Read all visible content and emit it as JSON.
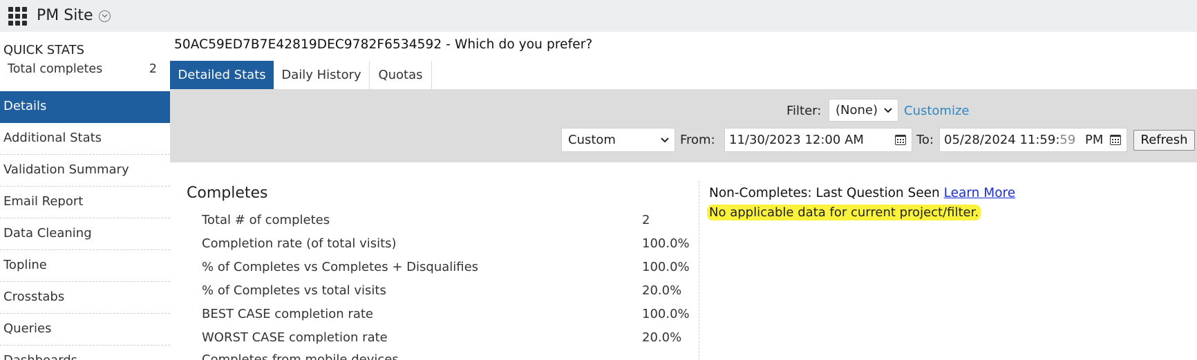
{
  "header": {
    "site_title": "PM Site"
  },
  "sidebar": {
    "quick_stats_title": "QUICK STATS",
    "quick_stats": [
      {
        "label": "Total completes",
        "value": "2"
      }
    ],
    "items": [
      {
        "label": "Details",
        "active": true
      },
      {
        "label": "Additional Stats"
      },
      {
        "label": "Validation Summary"
      },
      {
        "label": "Email Report"
      },
      {
        "label": "Data Cleaning"
      },
      {
        "label": "Topline"
      },
      {
        "label": "Crosstabs"
      },
      {
        "label": "Queries"
      },
      {
        "label": "Dashboards"
      }
    ]
  },
  "main": {
    "page_title": "50AC59ED7B7E42819DEC9782F6534592 - Which do you prefer?",
    "tabs": [
      {
        "label": "Detailed Stats",
        "active": true
      },
      {
        "label": "Daily History"
      },
      {
        "label": "Quotas"
      }
    ],
    "filter": {
      "filter_label": "Filter:",
      "filter_value": "(None)",
      "customize_label": "Customize",
      "range_value": "Custom",
      "from_label": "From:",
      "from_value": "11/30/2023 12:00 AM",
      "to_label": "To:",
      "to_value_main": "05/28/2024 11:59:",
      "to_value_seconds": "59",
      "to_value_ampm": "PM",
      "refresh_label": "Refresh"
    },
    "completes": {
      "title": "Completes",
      "rows": [
        {
          "label": "Total # of completes",
          "value": "2"
        },
        {
          "label": "Completion rate (of total visits)",
          "value": "100.0%"
        },
        {
          "label": "% of Completes vs Completes + Disqualifies",
          "value": "100.0%"
        },
        {
          "label": "% of Completes vs total visits",
          "value": "20.0%"
        },
        {
          "label": "BEST CASE completion rate",
          "value": "100.0%"
        },
        {
          "label": "WORST CASE completion rate",
          "value": "20.0%"
        },
        {
          "label": "Completes from mobile devices",
          "value": ""
        }
      ]
    },
    "non_completes": {
      "title": "Non-Completes: Last Question Seen",
      "learn_more": "Learn More",
      "message": "No applicable data for current project/filter."
    }
  },
  "colors": {
    "accent": "#1e5d9e",
    "link": "#2e86c7",
    "highlight": "#fbf23c"
  }
}
